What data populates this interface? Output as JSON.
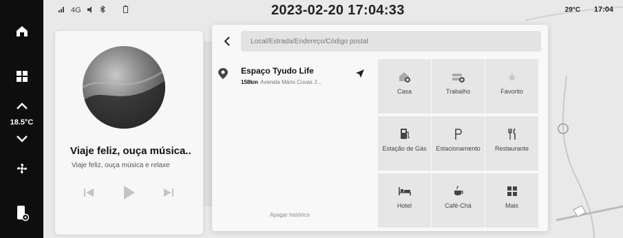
{
  "dock": {
    "temperature": "18.5°C",
    "icons": [
      "home-icon",
      "apps-grid-icon",
      "chevron-up-icon",
      "chevron-down-icon",
      "fan-icon",
      "phone-settings-icon"
    ]
  },
  "status_bar": {
    "signal": "4G",
    "datetime": "2023-02-20 17:04:33",
    "outside_temp": "29°C",
    "time": "17:04"
  },
  "music": {
    "title": "Viaje feliz, ouça música..",
    "subtitle": "Viaje feliz, ouça música e relaxe"
  },
  "search": {
    "placeholder": "Local/Estrada/Endereço/Código postal"
  },
  "result": {
    "name": "Espaço Tyudo Life",
    "distance": "158km",
    "address": "Avenida Mário Covas J..."
  },
  "clear_history": "Apagar histórico",
  "tiles": [
    {
      "icon": "home-plus-icon",
      "label": "Casa"
    },
    {
      "icon": "work-plus-icon",
      "label": "Trabalho"
    },
    {
      "icon": "star-icon",
      "label": "Favorito"
    },
    {
      "icon": "fuel-icon",
      "label": "Estação de Gás"
    },
    {
      "icon": "parking-icon",
      "label": "Estacionamento"
    },
    {
      "icon": "restaurant-icon",
      "label": "Restaurante"
    },
    {
      "icon": "hotel-icon",
      "label": "Hotel"
    },
    {
      "icon": "coffee-icon",
      "label": "Café-Chá"
    },
    {
      "icon": "more-grid-icon",
      "label": "Mais"
    }
  ],
  "colors": {
    "dock_bg": "#0e0e0e",
    "panel_bg": "#f8f8f8",
    "tile_bg": "#e6e6e6",
    "map_bg": "#e9e9e9"
  }
}
